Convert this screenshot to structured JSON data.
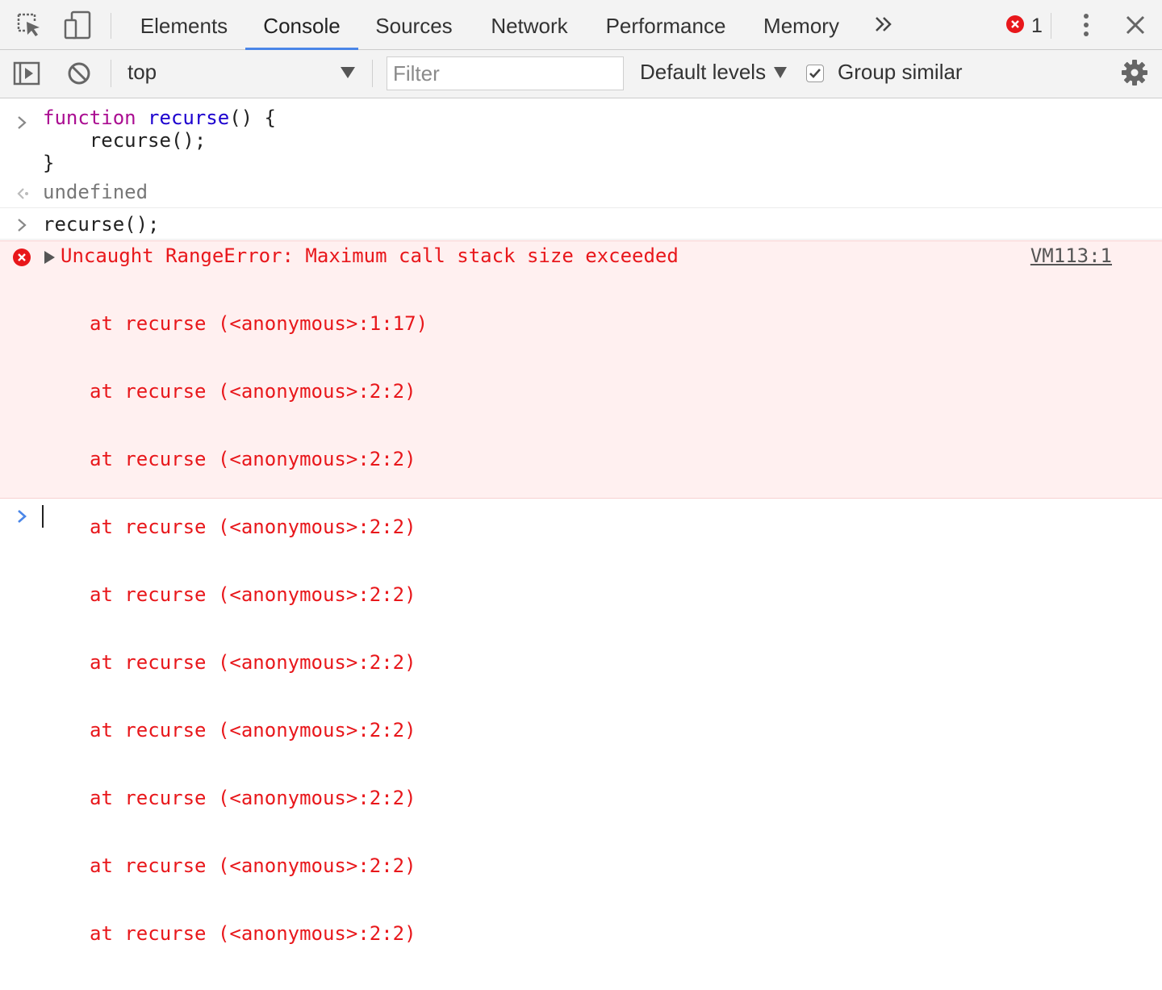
{
  "tabs": [
    {
      "label": "Elements",
      "active": false
    },
    {
      "label": "Console",
      "active": true
    },
    {
      "label": "Sources",
      "active": false
    },
    {
      "label": "Network",
      "active": false
    },
    {
      "label": "Performance",
      "active": false
    },
    {
      "label": "Memory",
      "active": false
    }
  ],
  "icons": {
    "inspect": "inspect-element-icon",
    "device": "device-toolbar-icon",
    "more_tabs": "chevron-double-right-icon",
    "error_badge": "error-circle-icon",
    "kebab": "kebab-menu-icon",
    "close": "close-icon",
    "sidebar": "show-sidebar-icon",
    "clear": "clear-console-icon",
    "settings": "gear-icon"
  },
  "error_count": "1",
  "toolbar": {
    "context": "top",
    "filter_placeholder": "Filter",
    "levels": "Default levels",
    "group_similar_label": "Group similar",
    "group_similar_checked": true
  },
  "console": {
    "input1": {
      "keyword": "function",
      "fn_name": "recurse",
      "sig_rest": "() {",
      "body_line": "    recurse();",
      "close_brace": "}"
    },
    "result1": "undefined",
    "input2": "recurse();",
    "error": {
      "title": "Uncaught RangeError: Maximum call stack size exceeded",
      "source": "VM113:1",
      "stack": [
        "at recurse (<anonymous>:1:17)",
        "at recurse (<anonymous>:2:2)",
        "at recurse (<anonymous>:2:2)",
        "at recurse (<anonymous>:2:2)",
        "at recurse (<anonymous>:2:2)",
        "at recurse (<anonymous>:2:2)",
        "at recurse (<anonymous>:2:2)",
        "at recurse (<anonymous>:2:2)",
        "at recurse (<anonymous>:2:2)",
        "at recurse (<anonymous>:2:2)"
      ]
    }
  },
  "colors": {
    "accent": "#4a86e8",
    "error_text": "#e8171b",
    "error_bg": "#fff0f0",
    "keyword": "#aa0d91",
    "function": "#1c00cf"
  }
}
